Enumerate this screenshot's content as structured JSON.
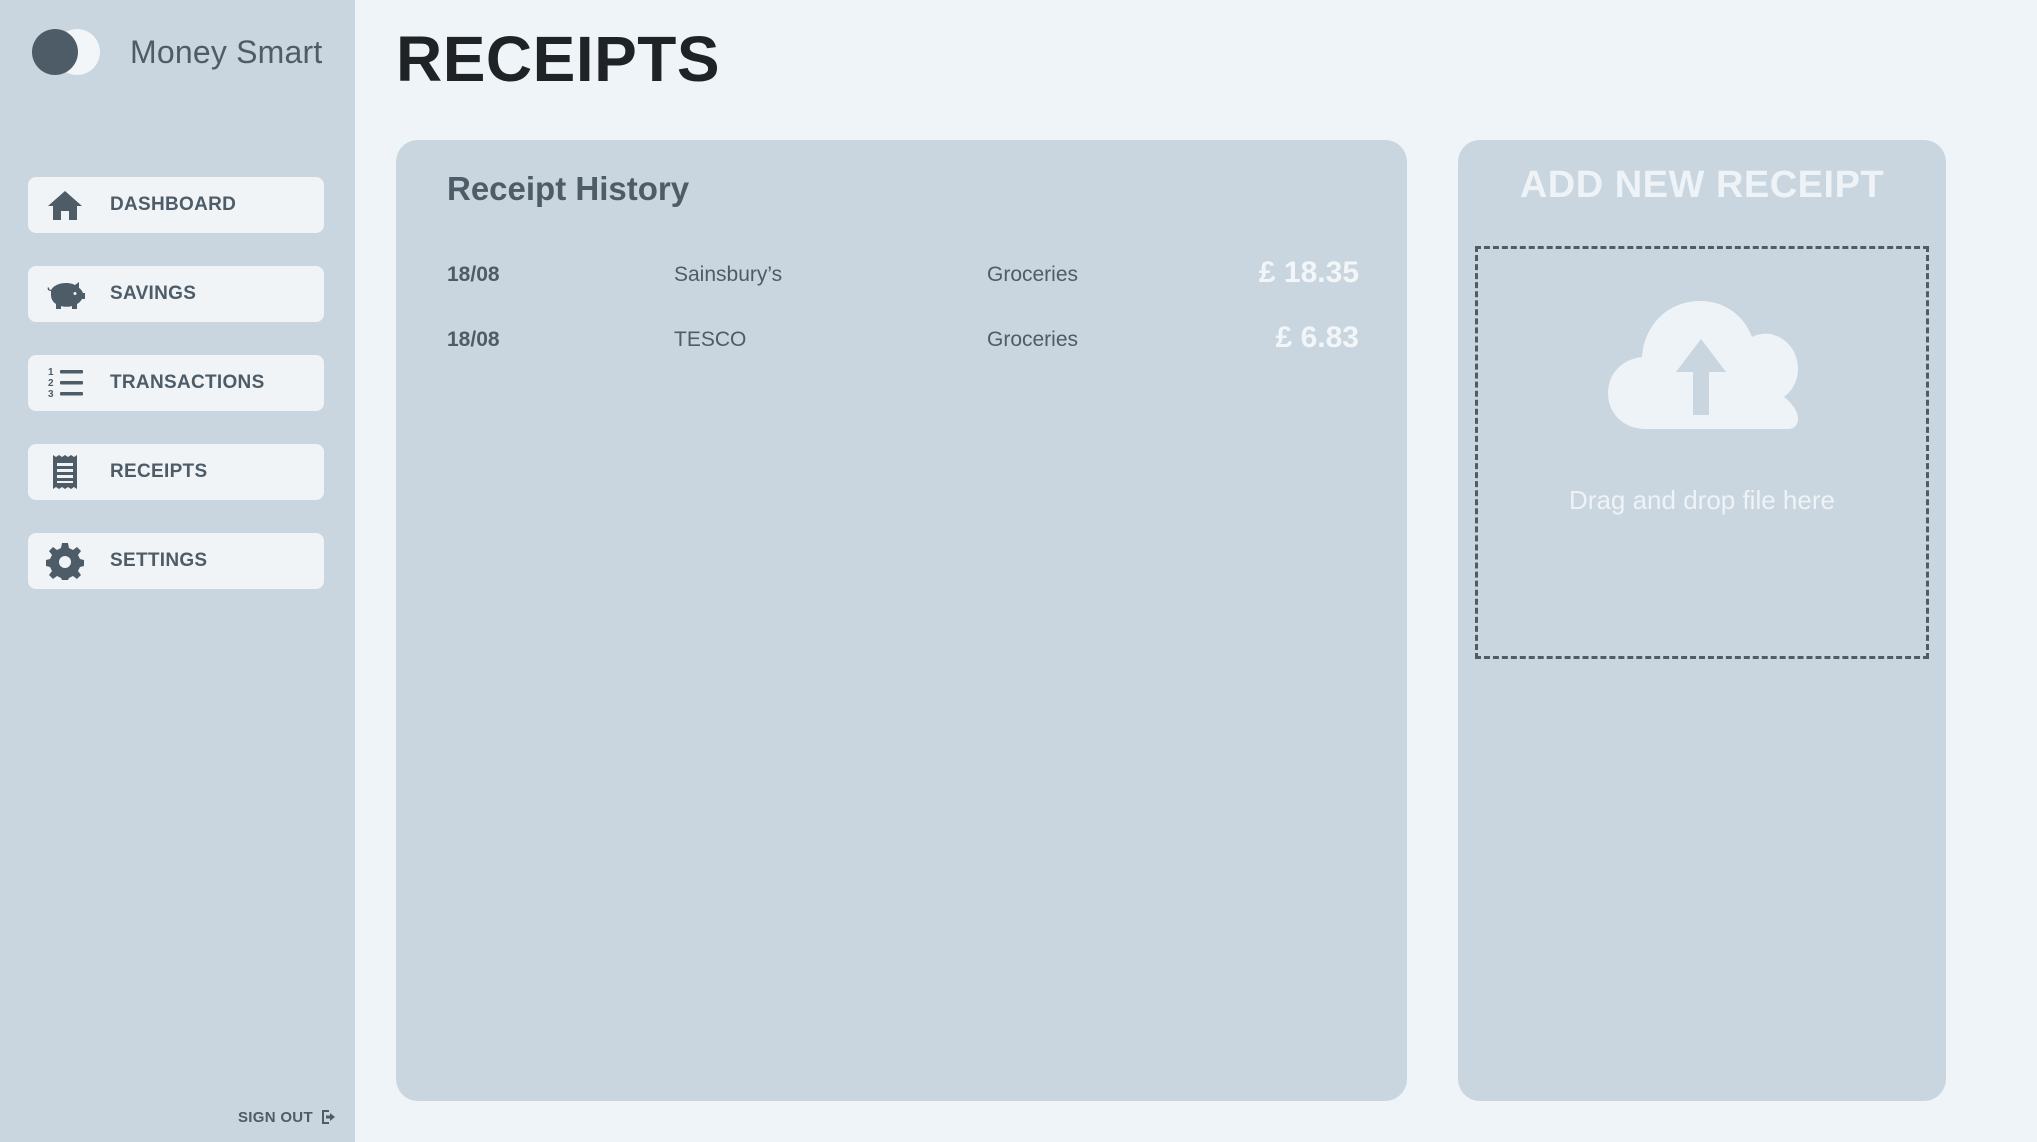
{
  "app": {
    "name": "Money Smart"
  },
  "sidebar": {
    "items": [
      {
        "label": "DASHBOARD",
        "icon": "home-icon"
      },
      {
        "label": "SAVINGS",
        "icon": "piggy-bank-icon"
      },
      {
        "label": "TRANSACTIONS",
        "icon": "numbered-list-icon"
      },
      {
        "label": "RECEIPTS",
        "icon": "receipt-icon"
      },
      {
        "label": "SETTINGS",
        "icon": "gear-icon"
      }
    ],
    "sign_out_label": "SIGN OUT",
    "sign_out_icon": "sign-out-icon"
  },
  "page": {
    "title": "RECEIPTS"
  },
  "history": {
    "title": "Receipt History",
    "rows": [
      {
        "date": "18/08",
        "store": "Sainsbury’s",
        "category": "Groceries",
        "amount": "£ 18.35"
      },
      {
        "date": "18/08",
        "store": "TESCO",
        "category": "Groceries",
        "amount": "£ 6.83"
      }
    ]
  },
  "upload": {
    "title": "ADD NEW RECEIPT",
    "drop_text": "Drag and drop file here",
    "icon": "cloud-upload-icon"
  },
  "colors": {
    "sidebar_bg": "#c9d6df",
    "page_bg": "#eef4f8",
    "accent_dark": "#4e5c67",
    "panel_bg": "#c9d6df",
    "light_text": "#f2f6f9"
  }
}
